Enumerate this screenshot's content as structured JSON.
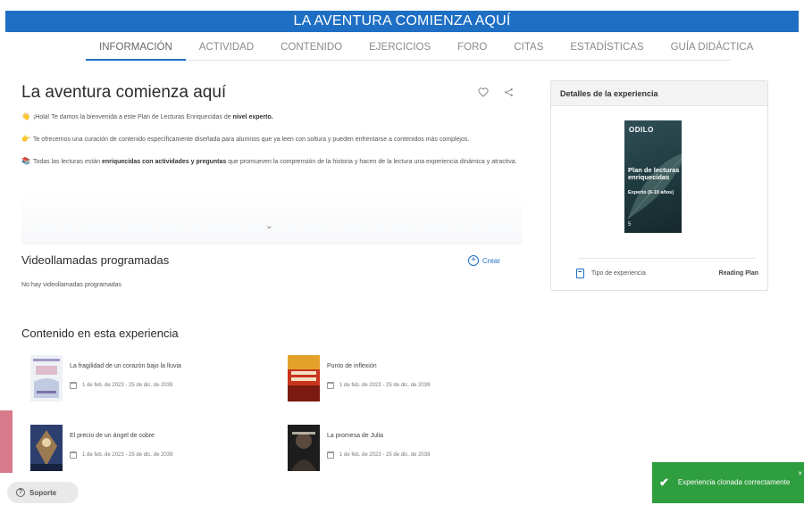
{
  "header": {
    "title": "LA AVENTURA COMIENZA AQUÍ"
  },
  "tabs": [
    {
      "label": "INFORMACIÓN"
    },
    {
      "label": "ACTIVIDAD"
    },
    {
      "label": "CONTENIDO"
    },
    {
      "label": "EJERCICIOS"
    },
    {
      "label": "FORO"
    },
    {
      "label": "CITAS"
    },
    {
      "label": "ESTADÍSTICAS"
    },
    {
      "label": "GUÍA DIDÁCTICA"
    }
  ],
  "main": {
    "title": "La aventura comienza aquí",
    "intro": {
      "p1_a": "¡Hola! Te damos la bienvenida a este Plan de Lecturas Enriquecidas de ",
      "p1_b": "nivel experto.",
      "p2": "Te ofrecemos una curación de contenido específicamente diseñada para alumnos que ya leen con soltura y pueden enfrentarse a contenidos más complejos.",
      "p3_a": "Todas las lecturas están ",
      "p3_b": "enriquecidas con actividades y preguntas",
      "p3_c": " que promueven la comprensión de la historia y hacen de la lectura una experiencia dinámica y atractiva."
    }
  },
  "video_calls": {
    "title": "Videollamadas programadas",
    "create_label": "Crear",
    "empty_text": "No hay videollamadas programadas"
  },
  "content": {
    "title": "Contenido en esta experiencia",
    "items": [
      {
        "title": "La fragilidad de un corazón bajo la lluvia",
        "date": "1 de feb. de 2023 - 25 de dic. de 2039"
      },
      {
        "title": "Punto de inflexión",
        "date": "1 de feb. de 2023 - 25 de dic. de 2039"
      },
      {
        "title": "El precio de un ángel de cobre",
        "date": "1 de feb. de 2023 - 25 de dic. de 2039"
      },
      {
        "title": "La promesa de Julia",
        "date": "1 de feb. de 2023 - 25 de dic. de 2039"
      }
    ]
  },
  "details": {
    "title": "Detalles de la experiencia",
    "book": {
      "logo": "ODILO",
      "title": "Plan de lecturas enriquecidas",
      "subtitle": "Experto (6-10 años)",
      "number": "5"
    },
    "type_label": "Tipo de experiencia",
    "type_value": "Reading Plan"
  },
  "support": {
    "label": "Soporte"
  },
  "toast": {
    "message": "Experiencia clonada correctamente"
  },
  "colors": {
    "primary": "#1e6fc4",
    "toast": "#2f9e3f"
  }
}
